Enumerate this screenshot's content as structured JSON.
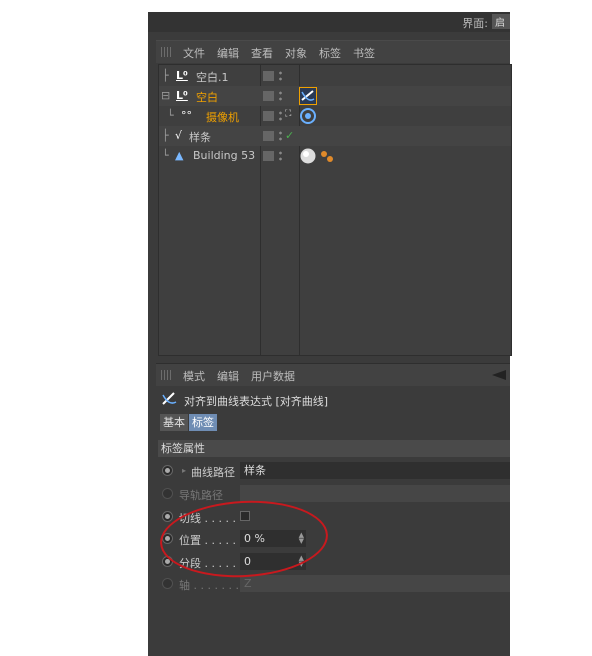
{
  "topbar": {
    "layout_label": "界面:",
    "layout_value": "启"
  },
  "menubar": {
    "items": [
      "文件",
      "编辑",
      "查看",
      "对象",
      "标签",
      "书签"
    ]
  },
  "objects": [
    {
      "name": "空白.1",
      "icon": "null-object-icon",
      "selected": false
    },
    {
      "name": "空白",
      "icon": "null-object-icon",
      "selected": true
    },
    {
      "name": "摄像机",
      "icon": "camera-icon",
      "selected": true
    },
    {
      "name": "样条",
      "icon": "spline-icon",
      "selected": false
    },
    {
      "name": "Building 53",
      "icon": "polygon-object-icon",
      "selected": false
    }
  ],
  "attributes": {
    "menu": [
      "模式",
      "编辑",
      "用户数据"
    ],
    "title": "对齐到曲线表达式 [对齐曲线]",
    "tabs": [
      {
        "label": "基本",
        "active": false
      },
      {
        "label": "标签",
        "active": true
      }
    ],
    "section": "标签属性",
    "props": {
      "curve_path": {
        "label": "曲线路径",
        "value": "样条"
      },
      "rail_path": {
        "label": "导轨路径",
        "value": ""
      },
      "tangential": {
        "label": "切线 . . . . .",
        "checked": false
      },
      "position": {
        "label": "位置 . . . . .",
        "value": "0 %"
      },
      "segment": {
        "label": "分段 . . . . .",
        "value": "0"
      },
      "axis": {
        "label": "轴 . . . . . . .",
        "value": "Z"
      }
    }
  },
  "colors": {
    "selected_text": "#f0a100",
    "active_tab": "#6f8db4",
    "annotation": "#c8191e"
  }
}
